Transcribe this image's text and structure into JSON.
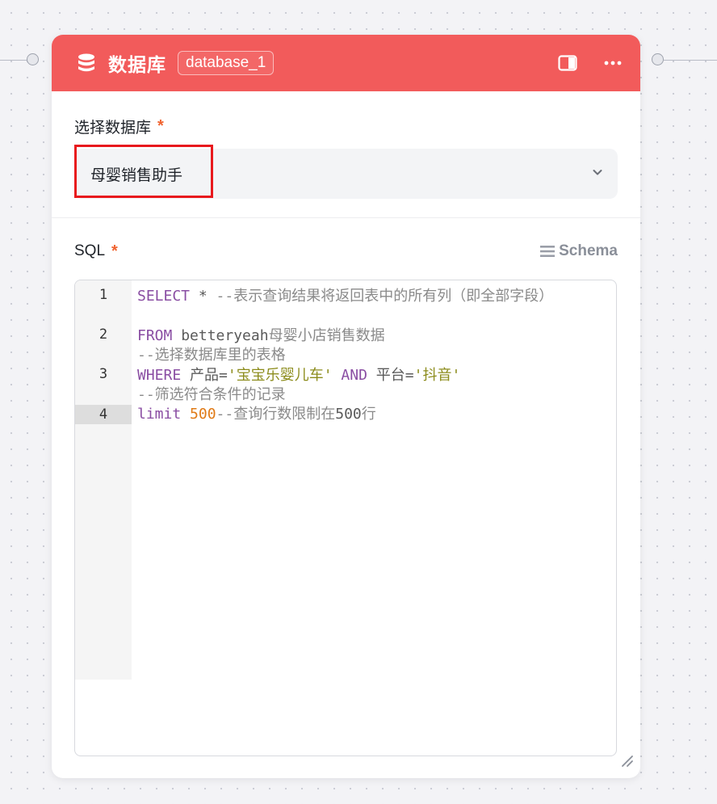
{
  "node": {
    "title": "数据库",
    "id": "database_1"
  },
  "database_field": {
    "label": "选择数据库",
    "required": "*",
    "value": "母婴销售助手"
  },
  "sql_field": {
    "label": "SQL",
    "required": "*",
    "schema_label": "Schema"
  },
  "sql_lines": [
    {
      "num": "1",
      "active": false,
      "parts": [
        [
          "kw",
          "SELECT"
        ],
        [
          "op",
          " * "
        ],
        [
          "cm",
          "--表示查询结果将返回表中的所有列（即全部字段）"
        ]
      ]
    },
    {
      "num": "2",
      "active": false,
      "parts": [
        [
          "kw",
          "FROM"
        ],
        [
          "op",
          " betteryeah"
        ],
        [
          "cm",
          "母婴小店销售数据\n--选择数据库里的表格"
        ]
      ]
    },
    {
      "num": "3",
      "active": false,
      "parts": [
        [
          "kw",
          "WHERE"
        ],
        [
          "op",
          " 产品="
        ],
        [
          "str",
          "'宝宝乐婴儿车'"
        ],
        [
          "op",
          " "
        ],
        [
          "kw",
          "AND"
        ],
        [
          "op",
          " 平台="
        ],
        [
          "str",
          "'抖音'"
        ],
        [
          "cm",
          "\n--筛选符合条件的记录"
        ]
      ]
    },
    {
      "num": "4",
      "active": true,
      "parts": [
        [
          "kw",
          "limit"
        ],
        [
          "op",
          " "
        ],
        [
          "num",
          "500"
        ],
        [
          "cm",
          "--查询行数限制在"
        ],
        [
          "op",
          "500"
        ],
        [
          "cm",
          "行"
        ]
      ]
    }
  ],
  "colors": {
    "header": "#f25b5b",
    "required_star": "#f0622e",
    "highlight": "#e8191d"
  },
  "icons": [
    "database-icon",
    "panel-toggle-icon",
    "more-icon",
    "chevron-down-icon",
    "list-icon",
    "resize-handle-icon"
  ]
}
